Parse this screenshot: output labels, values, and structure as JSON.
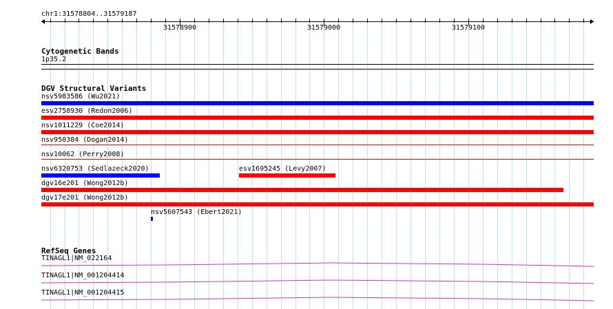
{
  "ruler": {
    "region_label": "chr1:31578804..31579187",
    "start": 31578804,
    "end": 31579187,
    "tick_labels": [
      "31578900",
      "31579000",
      "31579100"
    ]
  },
  "tracks": {
    "cytoband": {
      "title": "Cytogenetic Bands",
      "band_label": "1p35.2"
    },
    "dgv": {
      "title": "DGV Structural Variants",
      "features": [
        {
          "label": "nsv5983586 (Wu2021)",
          "color": "#0000ff",
          "start": 31578804,
          "end": 31579187
        },
        {
          "label": "esv2758930 (Redon2006)",
          "color": "#ff0000",
          "start": 31578804,
          "end": 31579187
        },
        {
          "label": "nsv1011229 (Coe2014)",
          "color": "#ff0000",
          "start": 31578804,
          "end": 31579187
        },
        {
          "label": "nsv950384 (Dogan2014)",
          "color": "#ff0000",
          "start": 31578804,
          "end": 31579187
        },
        {
          "label": "nsv10062 (Perry2008)",
          "color": "#ff0000",
          "start": 31578804,
          "end": 31579187
        },
        {
          "label": "nsv6320753 (Sedlazeck2020)",
          "color": "#0000ff",
          "start": 31578804,
          "end": 31578886
        },
        {
          "label": "esv1695245 (Levy2007)",
          "color": "#ff0000",
          "start": 31578941,
          "end": 31579008
        },
        {
          "label": "dgv16e201 (Wong2012b)",
          "color": "#ff0000",
          "start": 31578804,
          "end": 31579166
        },
        {
          "label": "dgv17e201 (Wong2012b)",
          "color": "#ff0000",
          "start": 31578804,
          "end": 31579187
        },
        {
          "label": "nsv5607543 (Ebert2021)",
          "color": "#0000ff",
          "start": 31578880,
          "end": 31578881
        }
      ]
    },
    "refseq": {
      "title": "RefSeq Genes",
      "color": "#cc33cc",
      "genes": [
        {
          "label": "TINAGL1|NM_022164"
        },
        {
          "label": "TINAGL1|NM_001204414"
        },
        {
          "label": "TINAGL1|NM_001204415"
        }
      ]
    }
  }
}
